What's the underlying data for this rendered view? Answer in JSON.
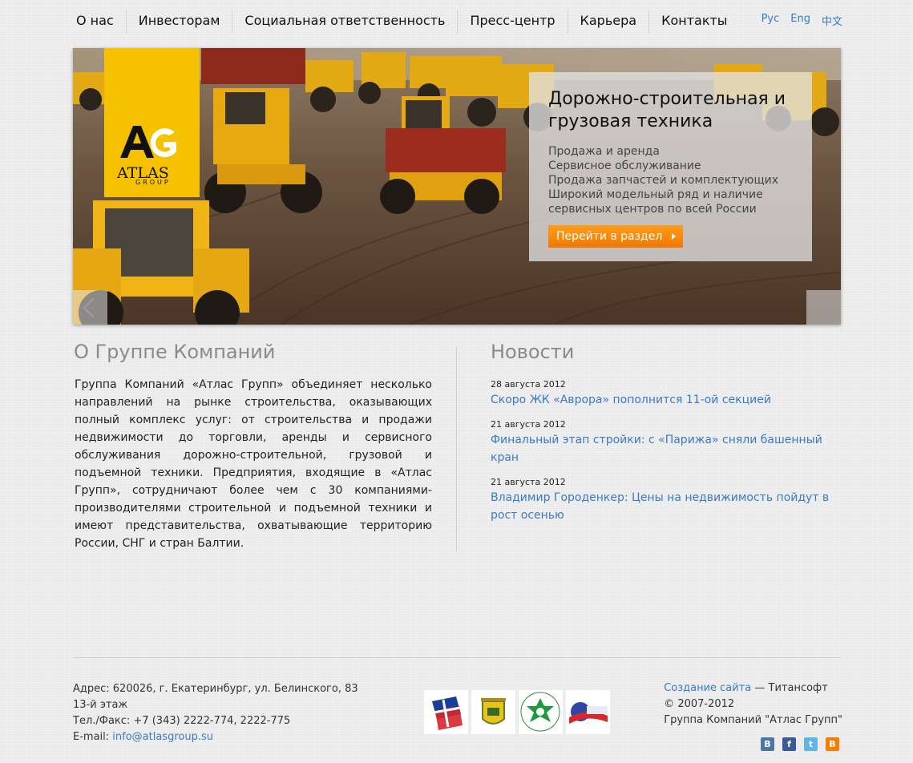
{
  "nav": {
    "items": [
      {
        "label": "О нас"
      },
      {
        "label": "Инвесторам"
      },
      {
        "label": "Социальная ответственность"
      },
      {
        "label": "Пресс-центр"
      },
      {
        "label": "Карьера"
      },
      {
        "label": "Контакты"
      }
    ],
    "languages": [
      "Рус",
      "Eng",
      "中文"
    ]
  },
  "banner": {
    "logo": {
      "ag": "AG",
      "atlas": "ATLAS",
      "group": "GROUP"
    },
    "title": "Дорожно-строительная и грузовая техника",
    "features": [
      "Продажа и аренда",
      "Сервисное обслуживание",
      "Продажа запчастей и комплектующих",
      "Широкий модельный ряд и наличие",
      "сервисных центров по всей России"
    ],
    "button_label": "Перейти в раздел"
  },
  "about": {
    "title": "О Группе Компаний",
    "text": "Группа Компаний «Атлас Групп» объединяет несколько направлений на рынке строительства, оказывающих полный комплекс услуг: от строительства и продажи недвижимости до торговли, аренды и сервисного обслуживания дорожно-строительной, грузовой и подъемной техники. Предприятия, входящие в «Атлас Групп», сотрудничают более чем с 30 компаниями-производителями строительной и подъемной техники и имеют представительства, охватывающие территорию России, СНГ и стран Балтии."
  },
  "news": {
    "title": "Новости",
    "items": [
      {
        "date": "28 августа 2012",
        "headline": "Скоро ЖК «Аврора» пополнится 11-ой секцией"
      },
      {
        "date": "21 августа 2012",
        "headline": "Финальный этап стройки: с «Парижа» сняли башенный кран"
      },
      {
        "date": "21 августа 2012",
        "headline": "Владимир Городенкер: Цены на недвижимость пойдут в рост осенью"
      }
    ]
  },
  "footer": {
    "address": "Адрес: 620026, г. Екатеринбург, ул. Белинского, 83",
    "floor": "13-й этаж",
    "phone": "Тел./Факс: +7 (343) 2222-774, 2222-775",
    "email_label": "E-mail: ",
    "email": "info@atlasgroup.su",
    "site_link": "Создание сайта",
    "site_credit": " — Титансофт",
    "copyright": "© 2007-2012",
    "company": "Группа Компаний \"Атлас Групп\"",
    "partners": [
      "rspp-logo",
      "coat-of-arms-logo",
      "green-emblem-logo",
      "association-logo"
    ],
    "socials": [
      "vkontakte-icon",
      "facebook-icon",
      "twitter-icon",
      "blogger-icon"
    ]
  },
  "colors": {
    "accent": "#3a7ac4",
    "logo_yellow": "#f5c100",
    "button_orange": "#f58a0b"
  }
}
